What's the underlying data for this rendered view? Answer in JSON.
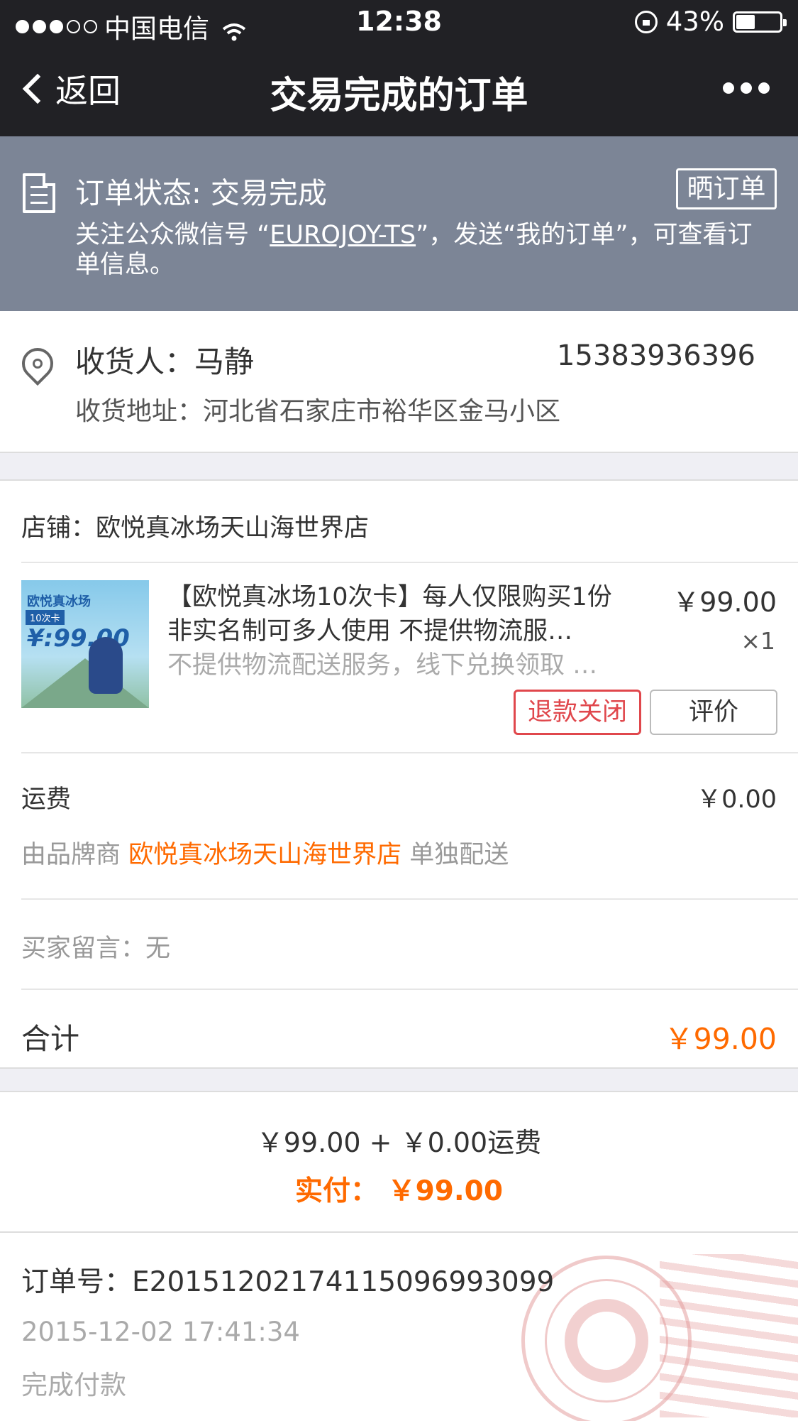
{
  "status_bar": {
    "carrier": "中国电信",
    "time": "12:38",
    "battery": "43%",
    "battery_level": 0.43
  },
  "nav": {
    "back_label": "返回",
    "title": "交易完成的订单"
  },
  "banner": {
    "status": "订单状态: 交易完成",
    "share_button": "晒订单",
    "tip_prefix": "关注公众微信号 “",
    "tip_account": "EUROJOY-TS",
    "tip_suffix": "”，发送“我的订单”，可查看订单信息。"
  },
  "address": {
    "receiver": "收货人：马静",
    "phone": "15383936396",
    "address": "收货地址：河北省石家庄市裕华区金马小区"
  },
  "order": {
    "shop": "店铺：欧悦真冰场天山海世界店",
    "product": {
      "title": "【欧悦真冰场10次卡】每人仅限购买1份 非实名制可多人使用 不提供物流服…",
      "subtitle": "不提供物流配送服务，线下兑换领取 …",
      "price": "￥99.00",
      "quantity": "×1",
      "thumb_brand": "欧悦真冰场",
      "thumb_tag": "10次卡",
      "thumb_price": "¥:99.00"
    },
    "refund_button": "退款关闭",
    "review_button": "评价",
    "freight_label": "运费",
    "freight_value": "￥0.00",
    "shipping_prefix": "由品牌商 ",
    "shipping_shop": "欧悦真冰场天山海世界店",
    "shipping_suffix": " 单独配送",
    "buyer_message": "买家留言：无",
    "total_label": "合计",
    "total_value": "￥99.00"
  },
  "payment": {
    "calc": "￥99.00 + ￥0.00运费",
    "actual": "实付： ￥99.00"
  },
  "info": {
    "order_no": "订单号：E20151202174115096993099",
    "datetime": "2015-12-02 17:41:34",
    "pay_status": "完成付款"
  },
  "colors": {
    "nav_bg": "#212125",
    "banner_bg": "#7c8596",
    "accent": "#ff6a00",
    "refund_red": "#e0474c"
  },
  "icons": [
    "back-chevron-icon",
    "more-icon",
    "document-icon",
    "location-pin-icon",
    "wifi-icon",
    "rotation-lock-icon",
    "battery-icon",
    "collection-stamp-icon"
  ]
}
